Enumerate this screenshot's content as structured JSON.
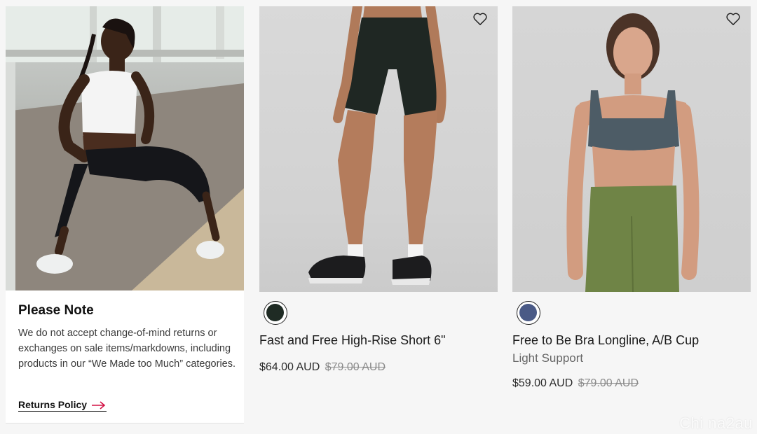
{
  "note": {
    "title": "Please Note",
    "body": "We do not accept change-of-mind returns or exchanges on sale items/markdowns, including products in our “We Made too Much” categories.",
    "link_label": "Returns Policy",
    "link_arrow_color": "#d31245"
  },
  "products": [
    {
      "name": "Fast and Free High-Rise Short 6\"",
      "subtitle": "",
      "price": "$64.00 AUD",
      "original_price": "$79.00 AUD",
      "swatch_color": "#1f2b24"
    },
    {
      "name": "Free to Be Bra Longline, A/B Cup",
      "subtitle": "Light Support",
      "price": "$59.00 AUD",
      "original_price": "$79.00 AUD",
      "swatch_color": "#4a5a86"
    }
  ],
  "watermark": "Chi na2au"
}
